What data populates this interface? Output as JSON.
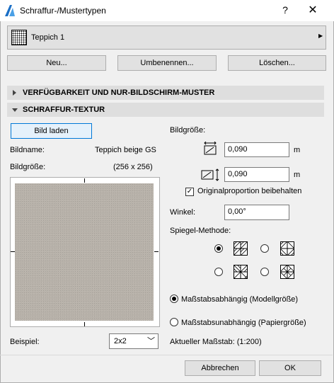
{
  "window": {
    "title": "Schraffur-/Mustertypen",
    "help": "?",
    "close": "✕"
  },
  "selector": {
    "label": "Teppich 1",
    "arrow": "▶"
  },
  "buttons": {
    "new": "Neu...",
    "rename": "Umbenennen...",
    "delete": "Löschen..."
  },
  "sections": {
    "availability": "VERFÜGBARKEIT UND NUR-BILDSCHIRM-MUSTER",
    "texture": "SCHRAFFUR-TEXTUR"
  },
  "texture": {
    "load_button": "Bild laden",
    "name_label": "Bildname:",
    "name_value": "Teppich beige GS",
    "size_label": "Bildgröße:",
    "size_value": "(256 x 256)",
    "sample_label": "Beispiel:",
    "sample_value": "2x2",
    "sample_arrow": "﹀"
  },
  "right": {
    "size_label": "Bildgröße:",
    "width_value": "0,090",
    "height_value": "0,090",
    "unit": "m",
    "keep_proportion_label": "Originalproportion beibehalten",
    "keep_proportion_checked": true,
    "angle_label": "Winkel:",
    "angle_value": "0,00°",
    "mirror_label": "Spiegel-Methode:",
    "scale_dependent_label": "Maßstabsabhängig (Modellgröße)",
    "scale_independent_label": "Maßstabsunabhängig (Papiergröße)",
    "current_scale_label": "Aktueller Maßstab: (1:200)"
  },
  "footer": {
    "cancel": "Abbrechen",
    "ok": "OK"
  }
}
